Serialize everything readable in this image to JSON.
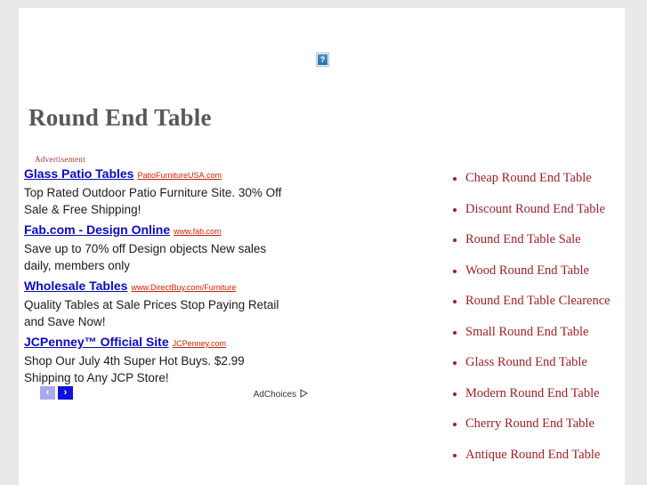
{
  "page": {
    "title": "Round End Table",
    "background_color": "#e9e9e9",
    "panel_color": "#ffffff"
  },
  "top_banner": {
    "image_status": "broken",
    "placeholder_glyph": "?",
    "icon_name": "broken-image-icon"
  },
  "ads": {
    "label": "Advertisement",
    "label_color": "#b03030",
    "headline_color": "#0a0ac2",
    "url_color": "#cc2200",
    "items": [
      {
        "headline": "Glass Patio Tables",
        "url": "PatioFurnitureUSA.com",
        "description": "Top Rated Outdoor Patio Furniture Site. 30% Off Sale & Free Shipping!"
      },
      {
        "headline": "Fab.com - Design Online",
        "url": "www.fab.com",
        "description": "Save up to 70% off Design objects New sales daily, members only"
      },
      {
        "headline": "Wholesale Tables",
        "url": "www.DirectBuy.com/Furniture",
        "description": "Quality Tables at Sale Prices Stop Paying Retail and Save Now!"
      },
      {
        "headline": "JCPenney™ Official Site",
        "url": "JCPenney.com",
        "description": "Shop Our July 4th Super Hot Buys. $2.99 Shipping to Any JCP Store!"
      }
    ],
    "footer": {
      "prev_label": "‹",
      "next_label": "›",
      "prev_color": "#a9a9ef",
      "next_color": "#1010dd",
      "adchoices_label": "AdChoices"
    }
  },
  "related_searches": {
    "text_color": "#a02028",
    "items": [
      {
        "label": "Cheap Round End Table"
      },
      {
        "label": "Discount Round End Table"
      },
      {
        "label": "Round End Table Sale"
      },
      {
        "label": "Wood Round End Table"
      },
      {
        "label": "Round End Table Clearence"
      },
      {
        "label": "Small Round End Table"
      },
      {
        "label": "Glass Round End Table"
      },
      {
        "label": "Modern Round End Table"
      },
      {
        "label": "Cherry Round End Table"
      },
      {
        "label": "Antique Round End Table"
      }
    ]
  }
}
